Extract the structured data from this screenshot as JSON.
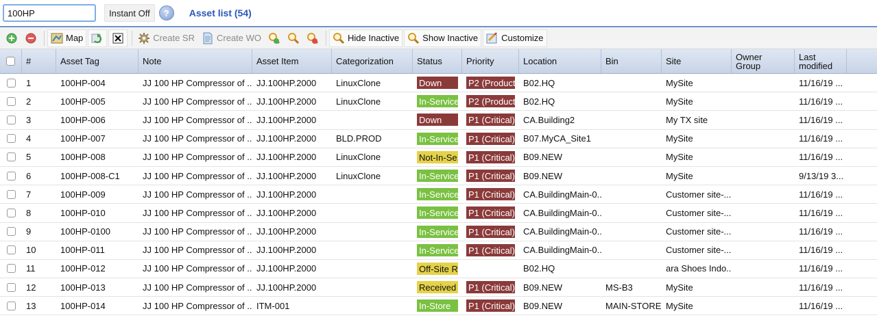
{
  "search": {
    "value": "100HP"
  },
  "topbar": {
    "instant_label": "Instant Off",
    "title": "Asset list (54)"
  },
  "toolbar": {
    "map_label": "Map",
    "create_sr_label": "Create SR",
    "create_wo_label": "Create WO",
    "hide_inactive_label": "Hide Inactive",
    "show_inactive_label": "Show Inactive",
    "customize_label": "Customize"
  },
  "table": {
    "headers": {
      "num": "#",
      "asset_tag": "Asset Tag",
      "note": "Note",
      "asset_item": "Asset Item",
      "categorization": "Categorization",
      "status": "Status",
      "priority": "Priority",
      "location": "Location",
      "bin": "Bin",
      "site": "Site",
      "owner_group_1": "Owner",
      "owner_group_2": "Group",
      "last_modified_1": "Last",
      "last_modified_2": "modified"
    },
    "rows": [
      {
        "num": "1",
        "tag": "100HP-004",
        "note": "JJ 100 HP Compressor of ...",
        "item": "JJ.100HP.2000",
        "cat": "LinuxClone",
        "status": "Down",
        "priority": "P2 (Product...",
        "location": "B02.HQ",
        "bin": "",
        "site": "MySite",
        "owner": "",
        "modified": "11/16/19 ..."
      },
      {
        "num": "2",
        "tag": "100HP-005",
        "note": "JJ 100 HP Compressor of ...",
        "item": "JJ.100HP.2000",
        "cat": "LinuxClone",
        "status": "In-Service",
        "priority": "P2 (Product...",
        "location": "B02.HQ",
        "bin": "",
        "site": "MySite",
        "owner": "",
        "modified": "11/16/19 ..."
      },
      {
        "num": "3",
        "tag": "100HP-006",
        "note": "JJ 100 HP Compressor of ...",
        "item": "JJ.100HP.2000",
        "cat": "",
        "status": "Down",
        "priority": "P1 (Critical)",
        "location": "CA.Building2",
        "bin": "",
        "site": "My TX site",
        "owner": "",
        "modified": "11/16/19 ..."
      },
      {
        "num": "4",
        "tag": "100HP-007",
        "note": "JJ 100 HP Compressor of ...",
        "item": "JJ.100HP.2000",
        "cat": "BLD.PROD",
        "status": "In-Service",
        "priority": "P1 (Critical)",
        "location": "B07.MyCA_Site1",
        "bin": "",
        "site": "MySite",
        "owner": "",
        "modified": "11/16/19 ..."
      },
      {
        "num": "5",
        "tag": "100HP-008",
        "note": "JJ 100 HP Compressor of ...",
        "item": "JJ.100HP.2000",
        "cat": "LinuxClone",
        "status": "Not-In-Se...",
        "priority": "P1 (Critical)",
        "location": "B09.NEW",
        "bin": "",
        "site": "MySite",
        "owner": "",
        "modified": "11/16/19 ..."
      },
      {
        "num": "6",
        "tag": "100HP-008-C1",
        "note": "JJ 100 HP Compressor of ...",
        "item": "JJ.100HP.2000",
        "cat": "LinuxClone",
        "status": "In-Service",
        "priority": "P1 (Critical)",
        "location": "B09.NEW",
        "bin": "",
        "site": "MySite",
        "owner": "",
        "modified": "9/13/19 3..."
      },
      {
        "num": "7",
        "tag": "100HP-009",
        "note": "JJ 100 HP Compressor of ...",
        "item": "JJ.100HP.2000",
        "cat": "",
        "status": "In-Service",
        "priority": "P1 (Critical)",
        "location": "CA.BuildingMain-0...",
        "bin": "",
        "site": "Customer site-...",
        "owner": "",
        "modified": "11/16/19 ..."
      },
      {
        "num": "8",
        "tag": "100HP-010",
        "note": "JJ 100 HP Compressor of ...",
        "item": "JJ.100HP.2000",
        "cat": "",
        "status": "In-Service",
        "priority": "P1 (Critical)",
        "location": "CA.BuildingMain-0...",
        "bin": "",
        "site": "Customer site-...",
        "owner": "",
        "modified": "11/16/19 ..."
      },
      {
        "num": "9",
        "tag": "100HP-0100",
        "note": "JJ 100 HP Compressor of ...",
        "item": "JJ.100HP.2000",
        "cat": "",
        "status": "In-Service",
        "priority": "P1 (Critical)",
        "location": "CA.BuildingMain-0...",
        "bin": "",
        "site": "Customer site-...",
        "owner": "",
        "modified": "11/16/19 ..."
      },
      {
        "num": "10",
        "tag": "100HP-011",
        "note": "JJ 100 HP Compressor of ...",
        "item": "JJ.100HP.2000",
        "cat": "",
        "status": "In-Service",
        "priority": "P1 (Critical)",
        "location": "CA.BuildingMain-0...",
        "bin": "",
        "site": "Customer site-...",
        "owner": "",
        "modified": "11/16/19 ..."
      },
      {
        "num": "11",
        "tag": "100HP-012",
        "note": "JJ 100 HP Compressor of ...",
        "item": "JJ.100HP.2000",
        "cat": "",
        "status": "Off-Site R...",
        "priority": "",
        "location": "B02.HQ",
        "bin": "",
        "site": "ara Shoes Indo...",
        "owner": "",
        "modified": "11/16/19 ..."
      },
      {
        "num": "12",
        "tag": "100HP-013",
        "note": "JJ 100 HP Compressor of ...",
        "item": "JJ.100HP.2000",
        "cat": "",
        "status": "Received",
        "priority": "P1 (Critical)",
        "location": "B09.NEW",
        "bin": "MS-B3",
        "site": "MySite",
        "owner": "",
        "modified": "11/16/19 ..."
      },
      {
        "num": "13",
        "tag": "100HP-014",
        "note": "JJ 100 HP Compressor of ...",
        "item": "ITM-001",
        "cat": "",
        "status": "In-Store",
        "priority": "P1 (Critical)",
        "location": "B09.NEW",
        "bin": "MAIN-STORE",
        "site": "MySite",
        "owner": "",
        "modified": "11/16/19 ..."
      }
    ]
  },
  "colors": {
    "status_down": "#8b3a3a",
    "status_in_service": "#7ac142",
    "status_yellow": "#e5d24a",
    "priority_bg": "#8b3a3a"
  }
}
